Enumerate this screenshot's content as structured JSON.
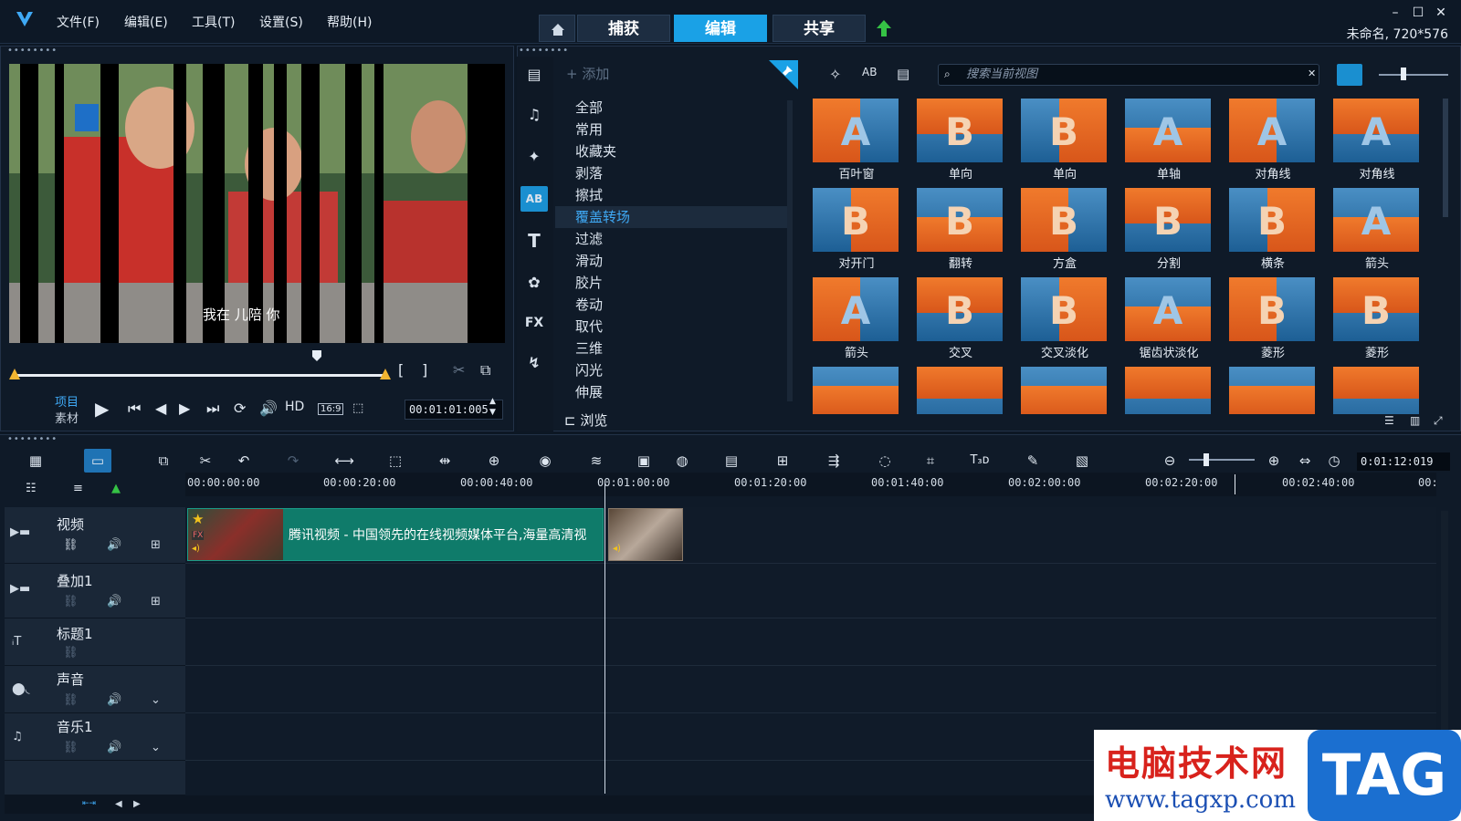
{
  "menu": [
    "文件(F)",
    "编辑(E)",
    "工具(T)",
    "设置(S)",
    "帮助(H)"
  ],
  "modes": {
    "capture": "捕获",
    "edit": "编辑",
    "share": "共享"
  },
  "project_info": "未命名, 720*576",
  "preview": {
    "subtitle": "我在   儿陪   你",
    "project_label": "项目",
    "clip_label": "素材",
    "hd": "HD",
    "aspect": "16:9",
    "timecode": "00:01:01:005"
  },
  "library": {
    "add_label": "添加",
    "categories": [
      "全部",
      "常用",
      "收藏夹",
      "剥落",
      "擦拭",
      "覆盖转场",
      "过滤",
      "滑动",
      "胶片",
      "卷动",
      "取代",
      "三维",
      "闪光",
      "伸展"
    ],
    "active_category": "覆盖转场",
    "browse_label": "浏览",
    "search_placeholder": "搜索当前视图",
    "thumbnails": [
      {
        "label": "百叶窗",
        "letter": "A"
      },
      {
        "label": "单向",
        "letter": "B"
      },
      {
        "label": "单向",
        "letter": "B"
      },
      {
        "label": "单轴",
        "letter": "A"
      },
      {
        "label": "对角线",
        "letter": "A"
      },
      {
        "label": "对角线",
        "letter": "A"
      },
      {
        "label": "对开门",
        "letter": "B"
      },
      {
        "label": "翻转",
        "letter": "B"
      },
      {
        "label": "方盒",
        "letter": "B"
      },
      {
        "label": "分割",
        "letter": "B"
      },
      {
        "label": "横条",
        "letter": "B"
      },
      {
        "label": "箭头",
        "letter": "A"
      },
      {
        "label": "箭头",
        "letter": "A"
      },
      {
        "label": "交叉",
        "letter": "B"
      },
      {
        "label": "交叉淡化",
        "letter": "B"
      },
      {
        "label": "锯齿状淡化",
        "letter": "A"
      },
      {
        "label": "菱形",
        "letter": "B"
      },
      {
        "label": "菱形",
        "letter": "B"
      }
    ]
  },
  "timeline": {
    "timecode": "0:01:12:019",
    "ruler": [
      "00:00:00:00",
      "00:00:20:00",
      "00:00:40:00",
      "00:01:00:00",
      "00:01:20:00",
      "00:01:40:00",
      "00:02:00:00",
      "00:02:20:00",
      "00:02:40:00",
      "00:"
    ],
    "tracks": [
      "视频",
      "叠加1",
      "标题1",
      "声音",
      "音乐1"
    ],
    "clip_title": "腾讯视频 - 中国领先的在线视频媒体平台,海量高清视"
  },
  "watermark": {
    "title": "电脑技术网",
    "url": "www.tagxp.com",
    "tag": "TAG"
  },
  "colors": {
    "accent": "#1aa1e6",
    "clip": "#0f7b6a",
    "bg": "#0c1724"
  }
}
